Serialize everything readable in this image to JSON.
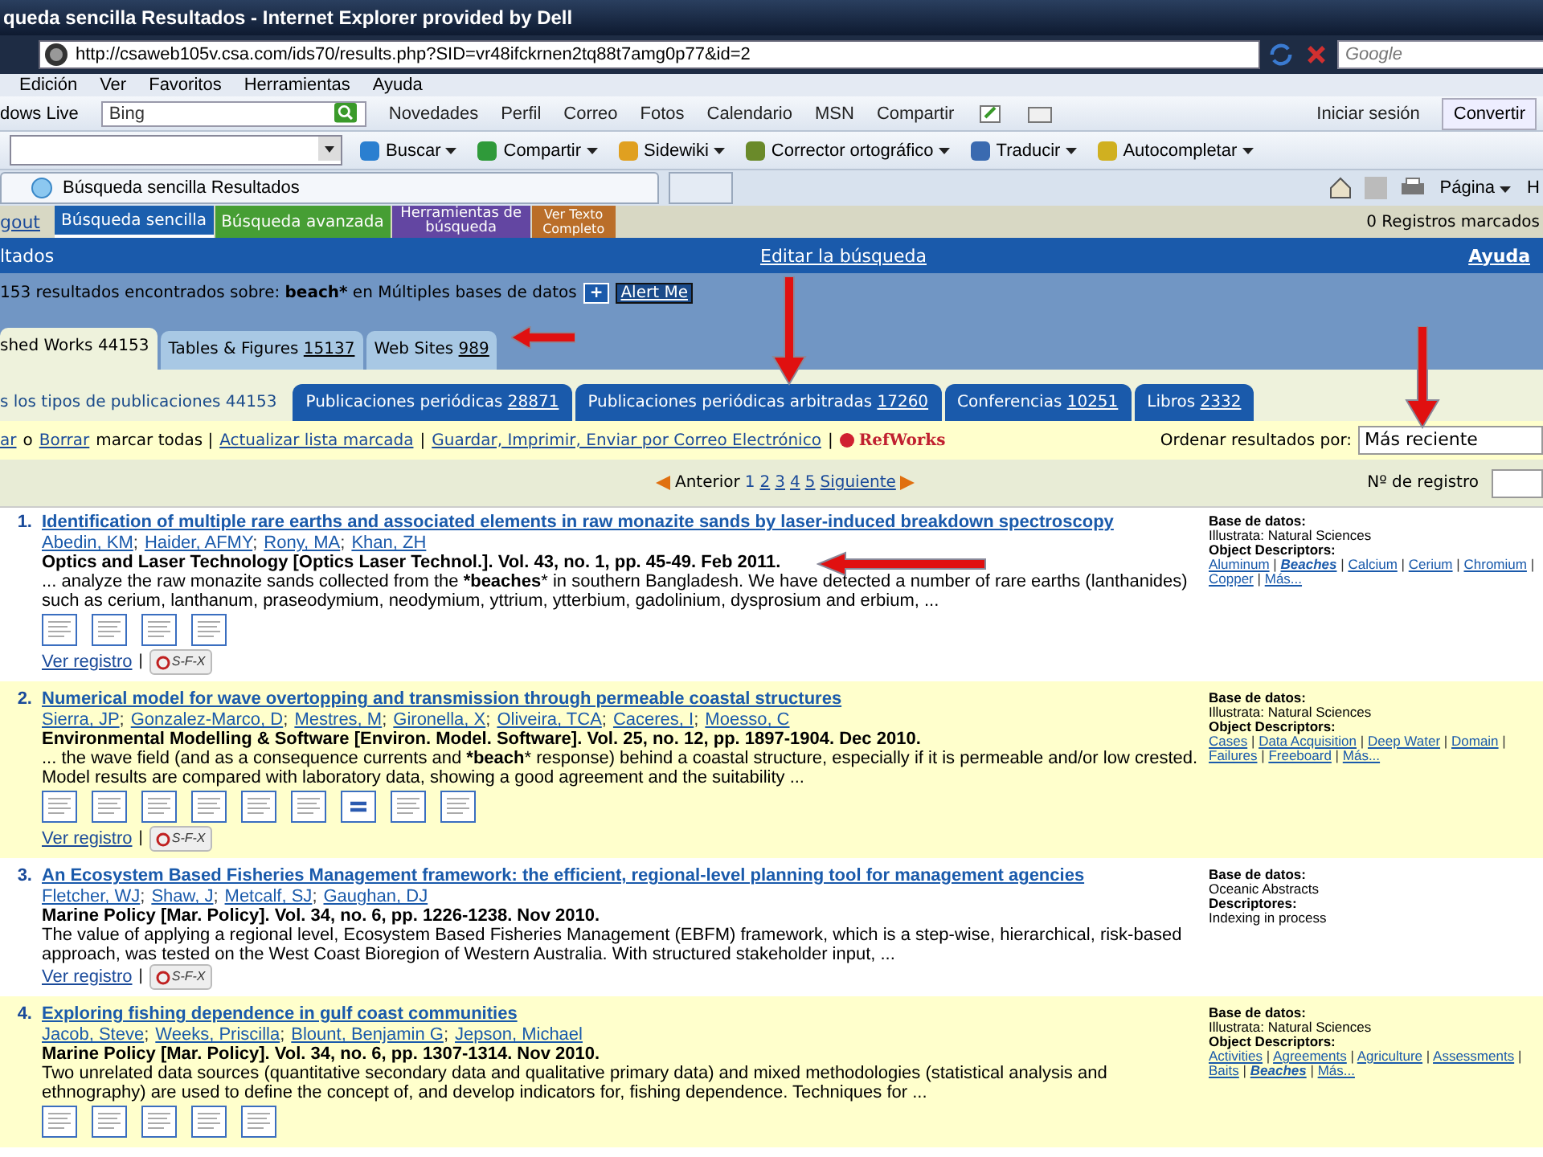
{
  "window": {
    "title": "queda sencilla Resultados - Internet Explorer provided by Dell"
  },
  "address_bar": {
    "url": "http://csaweb105v.csa.com/ids70/results.php?SID=vr48ifckrnen2tq88t7amg0p77&id=2",
    "search_placeholder": "Google"
  },
  "menu": [
    "Edición",
    "Ver",
    "Favoritos",
    "Herramientas",
    "Ayuda"
  ],
  "live_toolbar": {
    "brand": "dows Live",
    "search_value": "Bing",
    "links": [
      "Novedades",
      "Perfil",
      "Correo",
      "Fotos",
      "Calendario",
      "MSN",
      "Compartir"
    ],
    "sign_in": "Iniciar sesión",
    "convert": "Convertir"
  },
  "command_toolbar": {
    "buttons": [
      {
        "label": "Buscar",
        "kind": "search"
      },
      {
        "label": "Compartir",
        "kind": "share"
      },
      {
        "label": "Sidewiki",
        "kind": "wiki"
      },
      {
        "label": "Corrector ortográfico",
        "kind": "spell"
      },
      {
        "label": "Traducir",
        "kind": "translate"
      },
      {
        "label": "Autocompletar",
        "kind": "autofill"
      }
    ]
  },
  "browser_tab": {
    "title": "Búsqueda sencilla Resultados",
    "page_menu": "Página",
    "tools_menu": "H"
  },
  "site_nav": {
    "logout": "gout",
    "tabs": [
      {
        "label": "Búsqueda sencilla",
        "selected": true,
        "color": "#1b5fae"
      },
      {
        "label": "Búsqueda avanzada",
        "selected": false,
        "color": "#3a9a28"
      },
      {
        "label": "Herramientas de búsqueda",
        "selected": false,
        "color": "#5a3aa0"
      },
      {
        "label": "Ver Texto Completo",
        "selected": false,
        "color": "#b8661c"
      }
    ],
    "marked": "0 Registros marcados"
  },
  "header": {
    "title": "ltados",
    "edit_link": "Editar la búsqueda",
    "help": "Ayuda"
  },
  "summary": {
    "count_text": "153 resultados encontrados sobre:",
    "term": "beach*",
    "scope": "en Múltiples bases de datos",
    "plus": "+",
    "alert": "Alert Me"
  },
  "source_tabs": [
    {
      "label": "shed Works",
      "count": "44153",
      "selected": true
    },
    {
      "label": "Tables & Figures",
      "count": "15137",
      "selected": false
    },
    {
      "label": "Web Sites",
      "count": "989",
      "selected": false
    }
  ],
  "publication_tabs": [
    {
      "label": "s los tipos de publicaciones",
      "count": "44153",
      "selected": true
    },
    {
      "label": "Publicaciones periódicas",
      "count": "28871",
      "selected": false
    },
    {
      "label": "Publicaciones periódicas arbitradas",
      "count": "17260",
      "selected": false
    },
    {
      "label": "Conferencias",
      "count": "10251",
      "selected": false
    },
    {
      "label": "Libros",
      "count": "2332",
      "selected": false
    }
  ],
  "actions": [
    {
      "text": "ar",
      "kind": "link"
    },
    {
      "text": "o",
      "kind": "text"
    },
    {
      "text": "Borrar",
      "kind": "link"
    },
    {
      "text": "marcar todas |",
      "kind": "text"
    },
    {
      "text": "Actualizar lista marcada",
      "kind": "link"
    },
    {
      "text": "|",
      "kind": "text"
    },
    {
      "text": "Guardar, Imprimir, Enviar por Correo Electrónico",
      "kind": "link"
    },
    {
      "text": "|",
      "kind": "text"
    },
    {
      "text": "RefWorks",
      "kind": "refworks"
    }
  ],
  "sort": {
    "label": "Ordenar resultados por:",
    "value": "Más reciente"
  },
  "pagination": {
    "previous": "Anterior",
    "pages": [
      {
        "label": "1",
        "selected": true
      },
      {
        "label": "2",
        "selected": false
      },
      {
        "label": "3",
        "selected": false
      },
      {
        "label": "4",
        "selected": false
      },
      {
        "label": "5",
        "selected": false
      }
    ],
    "next": "Siguiente",
    "record_label": "Nº de registro"
  },
  "results": [
    {
      "number": "1.",
      "title": "Identification of multiple rare earths and associated elements in raw monazite sands by laser-induced breakdown spectroscopy",
      "authors": [
        "Abedin, KM",
        "Haider, AFMY",
        "Rony, MA",
        "Khan, ZH"
      ],
      "author_separator": ";",
      "view_separator": "|",
      "descriptor_separator": "|",
      "source": "Optics and Laser Technology [Optics Laser Technol.]. Vol. 43, no. 1, pp. 45-49. Feb 2011.",
      "abstract": "... analyze the raw monazite sands collected from the ***beaches*** in southern Bangladesh. We have detected a number of rare earths (lanthanides) such as cerium, lanthanum, praseodymium, neodymium, yttrium, ytterbium, gadolinium, dysprosium and erbium, ...",
      "thumbnails": [
        {
          "kind": "figure"
        },
        {
          "kind": "figure"
        },
        {
          "kind": "figure"
        },
        {
          "kind": "figure"
        }
      ],
      "view": "Ver registro",
      "sfx": "S-F-X",
      "database_label": "Base de datos:",
      "database": "Illustrata: Natural Sciences",
      "descriptors_label": "Object Descriptors:",
      "descriptors": [
        {
          "text": "Aluminum",
          "matched": false
        },
        {
          "text": "Beaches",
          "matched": true
        },
        {
          "text": "Calcium",
          "matched": false
        },
        {
          "text": "Cerium",
          "matched": false
        },
        {
          "text": "Chromium",
          "matched": false
        },
        {
          "text": "Copper",
          "matched": false
        },
        {
          "text": "Más...",
          "matched": false
        }
      ]
    },
    {
      "number": "2.",
      "title": "Numerical model for wave overtopping and transmission through permeable coastal structures",
      "authors": [
        "Sierra, JP",
        "Gonzalez-Marco, D",
        "Mestres, M",
        "Gironella, X",
        "Oliveira, TCA",
        "Caceres, I",
        "Moesso, C"
      ],
      "author_separator": ";",
      "view_separator": "|",
      "descriptor_separator": "|",
      "source": "Environmental Modelling & Software [Environ. Model. Software]. Vol. 25, no. 12, pp. 1897-1904. Dec 2010.",
      "abstract": "... the wave field (and as a consequence currents and ***beach*** response) behind a coastal structure, especially if it is permeable and/or low crested. Model results are compared with laboratory data, showing a good agreement and the suitability ...",
      "thumbnails": [
        {
          "kind": "figure"
        },
        {
          "kind": "figure"
        },
        {
          "kind": "figure"
        },
        {
          "kind": "figure"
        },
        {
          "kind": "figure"
        },
        {
          "kind": "figure"
        },
        {
          "kind": "table"
        },
        {
          "kind": "figure"
        },
        {
          "kind": "figure"
        }
      ],
      "view": "Ver registro",
      "sfx": "S-F-X",
      "database_label": "Base de datos:",
      "database": "Illustrata: Natural Sciences",
      "descriptors_label": "Object Descriptors:",
      "descriptors": [
        {
          "text": "Cases",
          "matched": false
        },
        {
          "text": "Data Acquisition",
          "matched": false
        },
        {
          "text": "Deep Water",
          "matched": false
        },
        {
          "text": "Domain",
          "matched": false
        },
        {
          "text": "Failures",
          "matched": false
        },
        {
          "text": "Freeboard",
          "matched": false
        },
        {
          "text": "Más...",
          "matched": false
        }
      ]
    },
    {
      "number": "3.",
      "title": "An Ecosystem Based Fisheries Management framework: the efficient, regional-level planning tool for management agencies",
      "authors": [
        "Fletcher, WJ",
        "Shaw, J",
        "Metcalf, SJ",
        "Gaughan, DJ"
      ],
      "author_separator": ";",
      "view_separator": "|",
      "source": "Marine Policy [Mar. Policy]. Vol. 34, no. 6, pp. 1226-1238. Nov 2010.",
      "abstract": "The value of applying a regional level, Ecosystem Based Fisheries Management (EBFM) framework, which is a step-wise, hierarchical, risk-based approach, was tested on the West Coast Bioregion of Western Australia. With structured stakeholder input, ...",
      "view": "Ver registro",
      "sfx": "S-F-X",
      "database_label": "Base de datos:",
      "database": "Oceanic Abstracts",
      "descriptors_label": "Descriptores:",
      "descriptors_note": "Indexing in process"
    },
    {
      "number": "4.",
      "title": "Exploring fishing dependence in gulf coast communities",
      "authors": [
        "Jacob, Steve",
        "Weeks, Priscilla",
        "Blount, Benjamin G",
        "Jepson, Michael"
      ],
      "author_separator": ";",
      "descriptor_separator": "|",
      "source": "Marine Policy [Mar. Policy]. Vol. 34, no. 6, pp. 1307-1314. Nov 2010.",
      "abstract": "Two unrelated data sources (quantitative secondary data and qualitative primary data) and mixed methodologies (statistical analysis and ethnography) are used to define the concept of, and develop indicators for, fishing dependence. Techniques for ...",
      "thumbnails": [
        {
          "kind": "figure"
        },
        {
          "kind": "figure"
        },
        {
          "kind": "figure"
        },
        {
          "kind": "figure"
        },
        {
          "kind": "figure"
        }
      ],
      "database_label": "Base de datos:",
      "database": "Illustrata: Natural Sciences",
      "descriptors_label": "Object Descriptors:",
      "descriptors": [
        {
          "text": "Activities",
          "matched": false
        },
        {
          "text": "Agreements",
          "matched": false
        },
        {
          "text": "Agriculture",
          "matched": false
        },
        {
          "text": "Assessments",
          "matched": false
        },
        {
          "text": "Baits",
          "matched": false
        },
        {
          "text": "Beaches",
          "matched": true
        },
        {
          "text": "Más...",
          "matched": false
        }
      ]
    }
  ]
}
